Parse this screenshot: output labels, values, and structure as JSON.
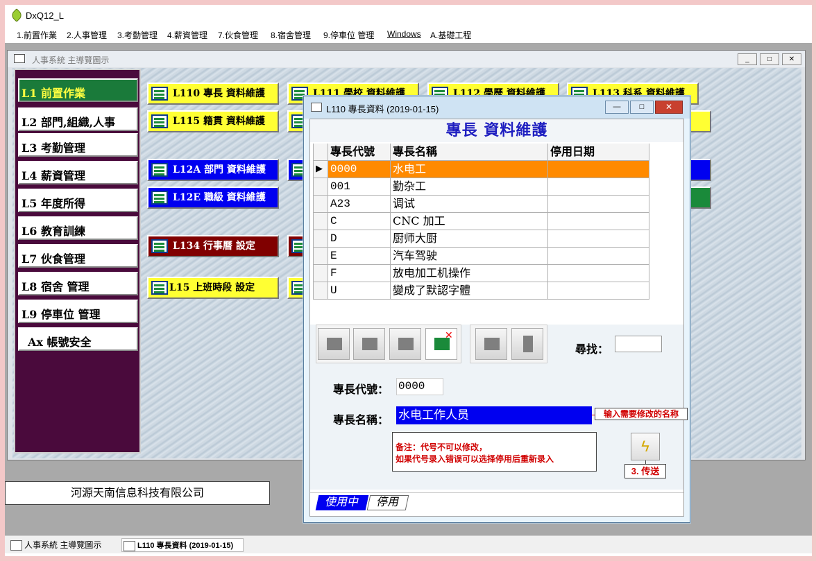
{
  "app": {
    "title": "DxQ12_L"
  },
  "menu": [
    "1.前置作業",
    "2.人事管理",
    "3.考勤管理",
    "4.薪資管理",
    "7.伙食管理",
    "8.宿舍管理",
    "9.停車位 管理",
    "Windows",
    "A.基礎工程"
  ],
  "mdi": {
    "title": "人事系統 主導覽圖示"
  },
  "nav": [
    {
      "label": "L1 前置作業",
      "active": true
    },
    {
      "label": "L2 部門,組織,人事"
    },
    {
      "label": "L3 考勤管理"
    },
    {
      "label": "L4 薪資管理"
    },
    {
      "label": "L5 年度所得"
    },
    {
      "label": "L6 教育訓練"
    },
    {
      "label": "L7 伙食管理"
    },
    {
      "label": "L8 宿舍 管理"
    },
    {
      "label": "L9 停車位 管理"
    },
    {
      "label": "Ax 帳號安全"
    }
  ],
  "tiles": {
    "l110": "L110 專長 資料維護",
    "l111": "L111 學校 資料維護",
    "l112": "L112 學歷 資料維護",
    "l113": "L113 科系 資料維護",
    "l115": "L115 籍貫 資料維護",
    "l12a": "L12A 部門 資料維護",
    "l12e": "L12E 職級 資料維護",
    "l134": "L134 行事曆 設定",
    "l15": "L15 上班時段 設定"
  },
  "company": "河源天南信息科技有限公司",
  "dialog": {
    "title": "L110 專長資料 (2019-01-15)",
    "header": "專長 資料維護",
    "columns": [
      "專長代號",
      "專長名稱",
      "停用日期"
    ],
    "rows": [
      {
        "code": "0000",
        "name": "水电工",
        "date": ""
      },
      {
        "code": "001",
        "name": "勤杂工",
        "date": ""
      },
      {
        "code": "A23",
        "name": "调试",
        "date": ""
      },
      {
        "code": "C",
        "name": "CNC 加工",
        "date": ""
      },
      {
        "code": "D",
        "name": "厨师大厨",
        "date": ""
      },
      {
        "code": "E",
        "name": "汽车驾驶",
        "date": ""
      },
      {
        "code": "F",
        "name": "放电加工机操作",
        "date": ""
      },
      {
        "code": "U",
        "name": "變成了默認字體",
        "date": ""
      }
    ],
    "search_label": "尋找：",
    "search_value": "",
    "code_label": "專長代號：",
    "code_value": "0000",
    "name_label": "專長名稱：",
    "name_value": "水电工作人员",
    "callout_name": "输入需要修改的名称",
    "note_line1": "备注：代号不可以修改，",
    "note_line2": "如果代号录入错误可以选择停用后重新录入",
    "send_label": "3. 传送",
    "tabs": [
      "使用中",
      "停用"
    ]
  },
  "taskbar": [
    "人事系統 主導覽圖示",
    "L110 專長資料 (2019-01-15)"
  ],
  "colors": {
    "accent_blue": "#0000f0",
    "selected_row": "#ff8a00",
    "nav_bg": "#4a0a3c",
    "tile_yellow": "#ffff33"
  }
}
